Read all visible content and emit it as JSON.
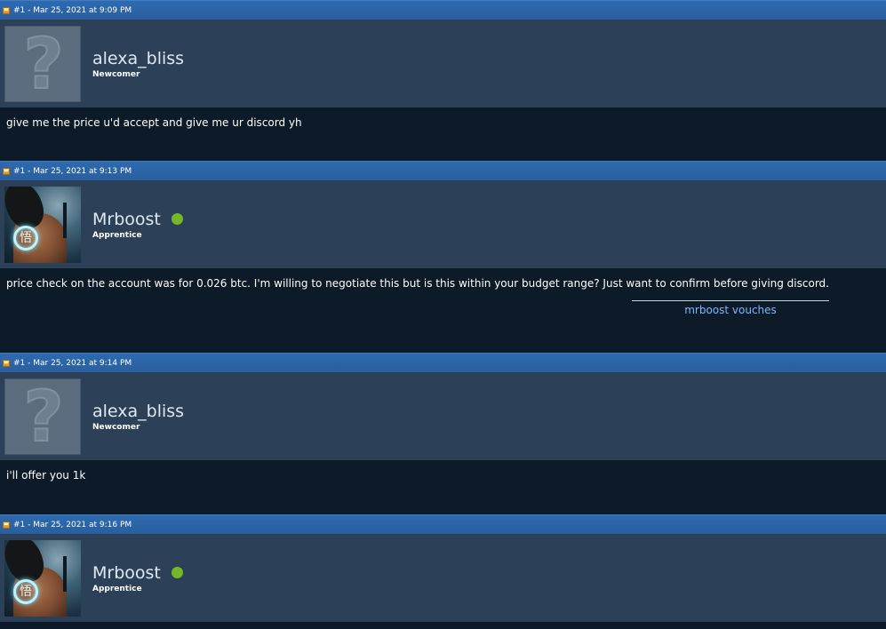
{
  "posts": [
    {
      "header": "#1 - Mar 25, 2021 at 9:09 PM",
      "username": "alexa_bliss",
      "rank": "Newcomer",
      "online": false,
      "avatar": "default-question-avatar",
      "body": "give me the price u'd accept and give me ur discord yh"
    },
    {
      "header": "#1 - Mar 25, 2021 at 9:13 PM",
      "username": "Mrboost",
      "rank": "Apprentice",
      "online": true,
      "avatar": "anime-character-avatar",
      "body": "price check on the account was for 0.026 btc. I'm willing to negotiate this but is this within your budget range? Just want to confirm before giving discord.",
      "signature_link": "mrboost vouches"
    },
    {
      "header": "#1 - Mar 25, 2021 at 9:14 PM",
      "username": "alexa_bliss",
      "rank": "Newcomer",
      "online": false,
      "avatar": "default-question-avatar",
      "body": "i'll offer you 1k"
    },
    {
      "header": "#1 - Mar 25, 2021 at 9:16 PM",
      "username": "Mrboost",
      "rank": "Apprentice",
      "online": true,
      "avatar": "anime-character-avatar"
    }
  ],
  "colors": {
    "header_bar": "#2a5f9e",
    "user_bar": "#2c4158",
    "body_bg": "#0d1b28",
    "online": "#74b82a",
    "link": "#7fb6ff"
  }
}
